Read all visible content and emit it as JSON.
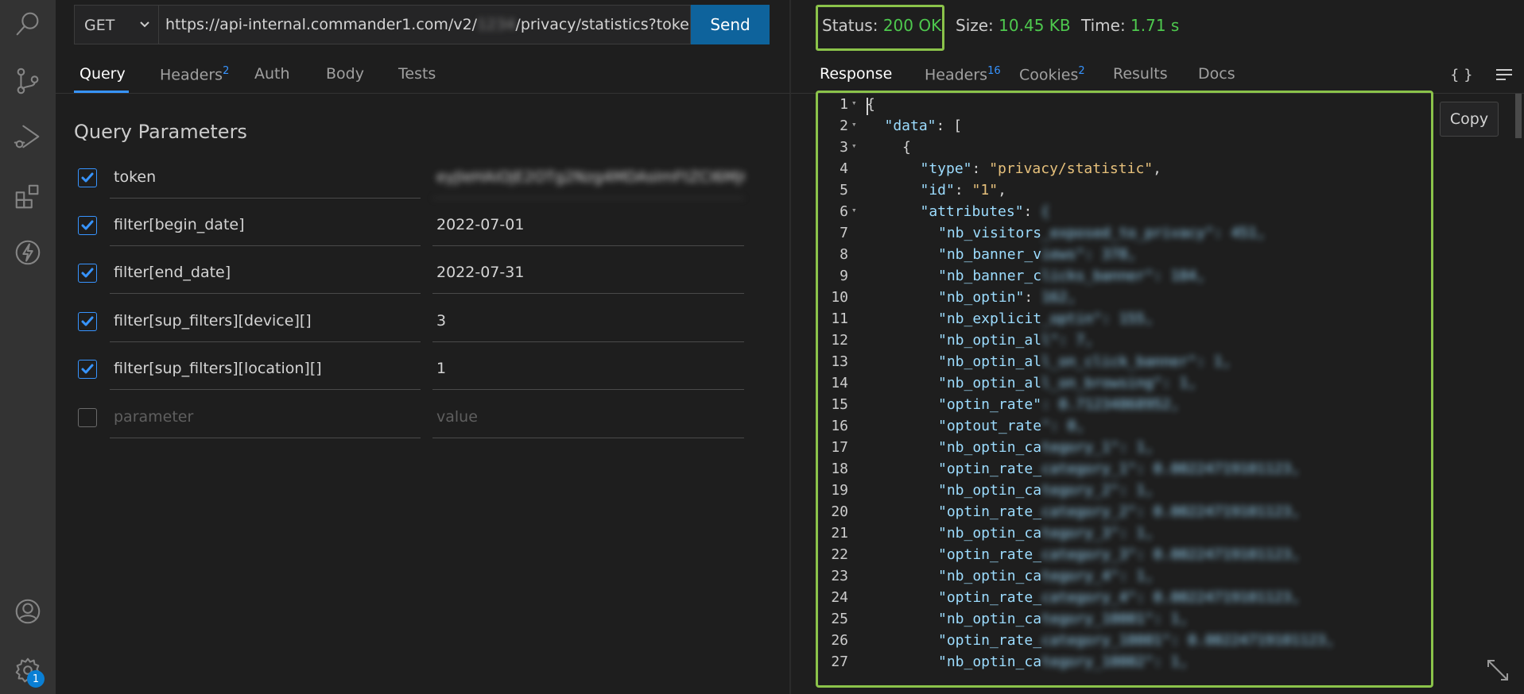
{
  "request": {
    "method": "GET",
    "url_prefix": "https://api-internal.commander1.com/v2/",
    "url_hidden": "1234",
    "url_suffix": "/privacy/statistics?token=eyJle",
    "send_label": "Send"
  },
  "request_tabs": [
    {
      "label": "Query",
      "count": ""
    },
    {
      "label": "Headers",
      "count": "2"
    },
    {
      "label": "Auth",
      "count": ""
    },
    {
      "label": "Body",
      "count": ""
    },
    {
      "label": "Tests",
      "count": ""
    }
  ],
  "query": {
    "title": "Query Parameters",
    "params": [
      {
        "name": "token",
        "value": "eyJleHAiOjE2OTg2Nzg4MDAsImFtZCI6MjQ4",
        "checked": true,
        "hidden": true
      },
      {
        "name": "filter[begin_date]",
        "value": "2022-07-01",
        "checked": true
      },
      {
        "name": "filter[end_date]",
        "value": "2022-07-31",
        "checked": true
      },
      {
        "name": "filter[sup_filters][device][]",
        "value": "3",
        "checked": true
      },
      {
        "name": "filter[sup_filters][location][]",
        "value": "1",
        "checked": true
      }
    ],
    "placeholder_name": "parameter",
    "placeholder_value": "value"
  },
  "response": {
    "status_label": "Status:",
    "status_value": "200 OK",
    "size_label": "Size:",
    "size_value": "10.45 KB",
    "time_label": "Time:",
    "time_value": "1.71 s",
    "copy_label": "Copy",
    "format_icon": "{ }"
  },
  "response_tabs": [
    {
      "label": "Response",
      "count": ""
    },
    {
      "label": "Headers",
      "count": "16"
    },
    {
      "label": "Cookies",
      "count": "2"
    },
    {
      "label": "Results",
      "count": ""
    },
    {
      "label": "Docs",
      "count": ""
    }
  ],
  "settings_badge": "1",
  "colors": {
    "accent": "#3794ff",
    "ok": "#4ec94e",
    "highlight": "#8bc34a",
    "send": "#0e639c"
  },
  "code_lines": [
    {
      "n": "1",
      "fold": true,
      "indent": 0,
      "text": "{"
    },
    {
      "n": "2",
      "fold": true,
      "indent": 1,
      "key": "\"data\"",
      "rest": ": ["
    },
    {
      "n": "3",
      "fold": true,
      "indent": 2,
      "text": "{"
    },
    {
      "n": "4",
      "indent": 3,
      "key": "\"type\"",
      "rest": ": ",
      "str": "\"privacy/statistic\"",
      "tail": ","
    },
    {
      "n": "5",
      "indent": 3,
      "key": "\"id\"",
      "rest": ": ",
      "str": "\"1\"",
      "tail": ","
    },
    {
      "n": "6",
      "fold": true,
      "indent": 3,
      "key": "\"attributes\"",
      "rest": ": ",
      "hidden": "{"
    },
    {
      "n": "7",
      "indent": 4,
      "key": "\"nb_visitors",
      "hidden": "_exposed_to_privacy\": 451,"
    },
    {
      "n": "8",
      "indent": 4,
      "key": "\"nb_banner_v",
      "hidden": "iews\": 378,"
    },
    {
      "n": "9",
      "indent": 4,
      "key": "\"nb_banner_c",
      "hidden": "licks_banner\": 184,"
    },
    {
      "n": "10",
      "indent": 4,
      "key": "\"nb_optin\"",
      "rest": ": ",
      "hidden": "162,"
    },
    {
      "n": "11",
      "indent": 4,
      "key": "\"nb_explicit",
      "hidden": "_optin\": 155,"
    },
    {
      "n": "12",
      "indent": 4,
      "key": "\"nb_optin_al",
      "hidden": "l\": 7,"
    },
    {
      "n": "13",
      "indent": 4,
      "key": "\"nb_optin_al",
      "hidden": "l_on_click_banner\": 1,"
    },
    {
      "n": "14",
      "indent": 4,
      "key": "\"nb_optin_al",
      "hidden": "l_on_browsing\": 1,"
    },
    {
      "n": "15",
      "indent": 4,
      "key": "\"optin_rate\"",
      "hidden": ": 0.71234868952,"
    },
    {
      "n": "16",
      "indent": 4,
      "key": "\"optout_rate",
      "hidden": "\": 0,"
    },
    {
      "n": "17",
      "indent": 4,
      "key": "\"nb_optin_ca",
      "hidden": "tegory_1\": 1,"
    },
    {
      "n": "18",
      "indent": 4,
      "key": "\"optin_rate_",
      "hidden": "category_1\": 0.00224719101123,"
    },
    {
      "n": "19",
      "indent": 4,
      "key": "\"nb_optin_ca",
      "hidden": "tegory_2\": 1,"
    },
    {
      "n": "20",
      "indent": 4,
      "key": "\"optin_rate_",
      "hidden": "category_2\": 0.00224719101123,"
    },
    {
      "n": "21",
      "indent": 4,
      "key": "\"nb_optin_ca",
      "hidden": "tegory_3\": 1,"
    },
    {
      "n": "22",
      "indent": 4,
      "key": "\"optin_rate_",
      "hidden": "category_3\": 0.00224719101123,"
    },
    {
      "n": "23",
      "indent": 4,
      "key": "\"nb_optin_ca",
      "hidden": "tegory_4\": 1,"
    },
    {
      "n": "24",
      "indent": 4,
      "key": "\"optin_rate_",
      "hidden": "category_4\": 0.00224719101123,"
    },
    {
      "n": "25",
      "indent": 4,
      "key": "\"nb_optin_ca",
      "hidden": "tegory_10001\": 1,"
    },
    {
      "n": "26",
      "indent": 4,
      "key": "\"optin_rate_",
      "hidden": "category_10001\": 0.00224719101123,"
    },
    {
      "n": "27",
      "indent": 4,
      "key": "\"nb_optin_ca",
      "hidden": "tegory_10002\": 1,"
    }
  ]
}
